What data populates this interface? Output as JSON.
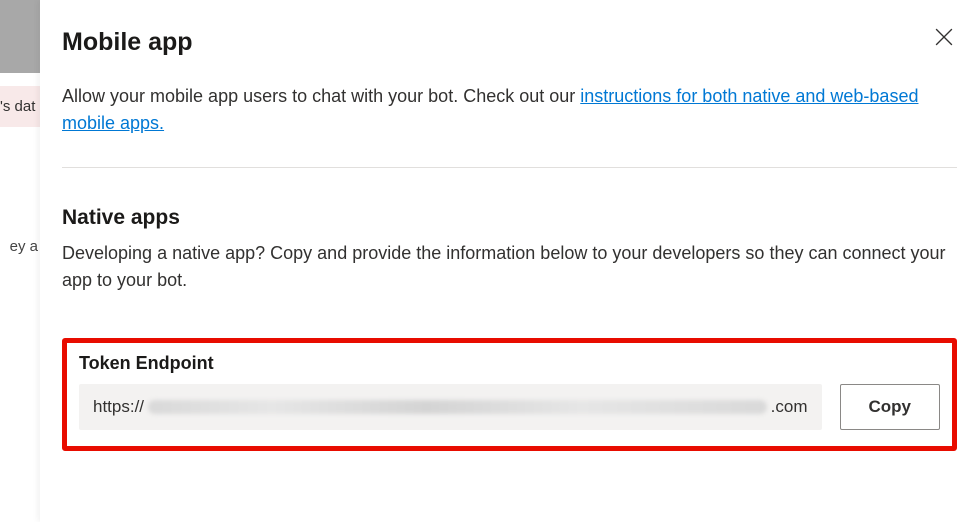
{
  "background": {
    "text1": "'s dat",
    "text2": "ey a"
  },
  "panel": {
    "title": "Mobile app",
    "close_label": "Close",
    "description_prefix": "Allow your mobile app users to chat with your bot. Check out our ",
    "link_text": "instructions for both native and web-based mobile apps.",
    "native": {
      "title": "Native apps",
      "description": "Developing a native app? Copy and provide the information below to your developers so they can connect your app to your bot."
    },
    "token": {
      "label": "Token Endpoint",
      "value_prefix": "https://",
      "value_suffix": ".com",
      "copy_label": "Copy"
    }
  }
}
